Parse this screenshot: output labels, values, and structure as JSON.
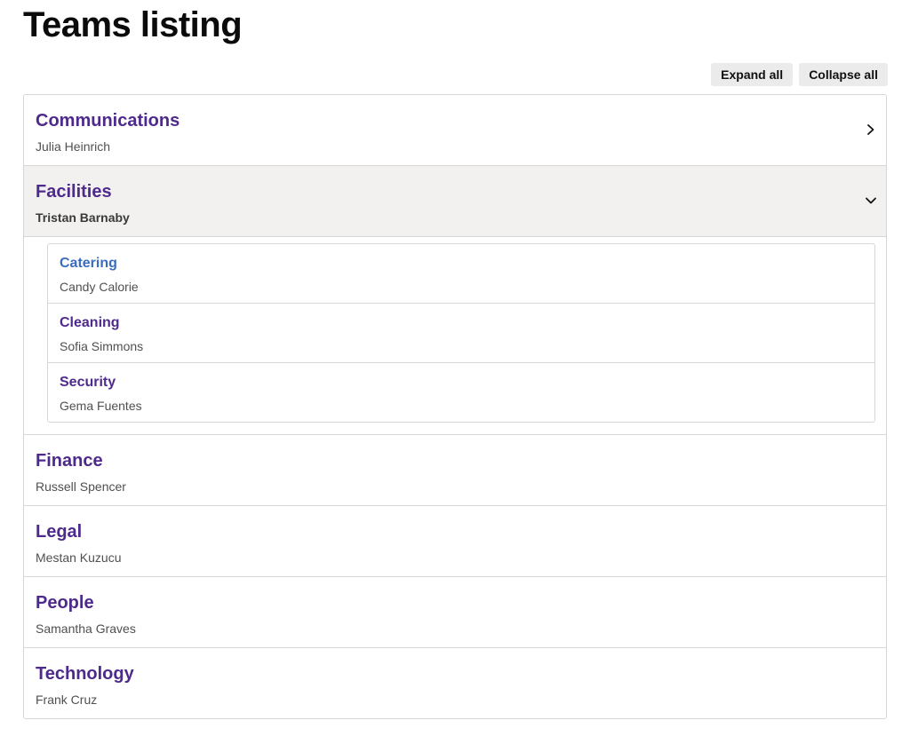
{
  "page": {
    "title": "Teams listing"
  },
  "controls": {
    "expand_all": "Expand all",
    "collapse_all": "Collapse all"
  },
  "colors": {
    "link": "#4e2a8c",
    "visited_link": "#3a6cc0",
    "expanded_bg": "#f2f1f0",
    "border": "#d6d6d6"
  },
  "teams": [
    {
      "name": "Communications",
      "lead": "Julia Heinrich",
      "expanded": false
    },
    {
      "name": "Facilities",
      "lead": "Tristan Barnaby",
      "expanded": true,
      "subteams": [
        {
          "name": "Catering",
          "lead": "Candy Calorie",
          "visited": true
        },
        {
          "name": "Cleaning",
          "lead": "Sofia Simmons",
          "visited": false
        },
        {
          "name": "Security",
          "lead": "Gema Fuentes",
          "visited": false
        }
      ]
    },
    {
      "name": "Finance",
      "lead": "Russell Spencer",
      "expanded": false
    },
    {
      "name": "Legal",
      "lead": "Mestan Kuzucu",
      "expanded": false
    },
    {
      "name": "People",
      "lead": "Samantha Graves",
      "expanded": false
    },
    {
      "name": "Technology",
      "lead": "Frank Cruz",
      "expanded": false
    }
  ]
}
